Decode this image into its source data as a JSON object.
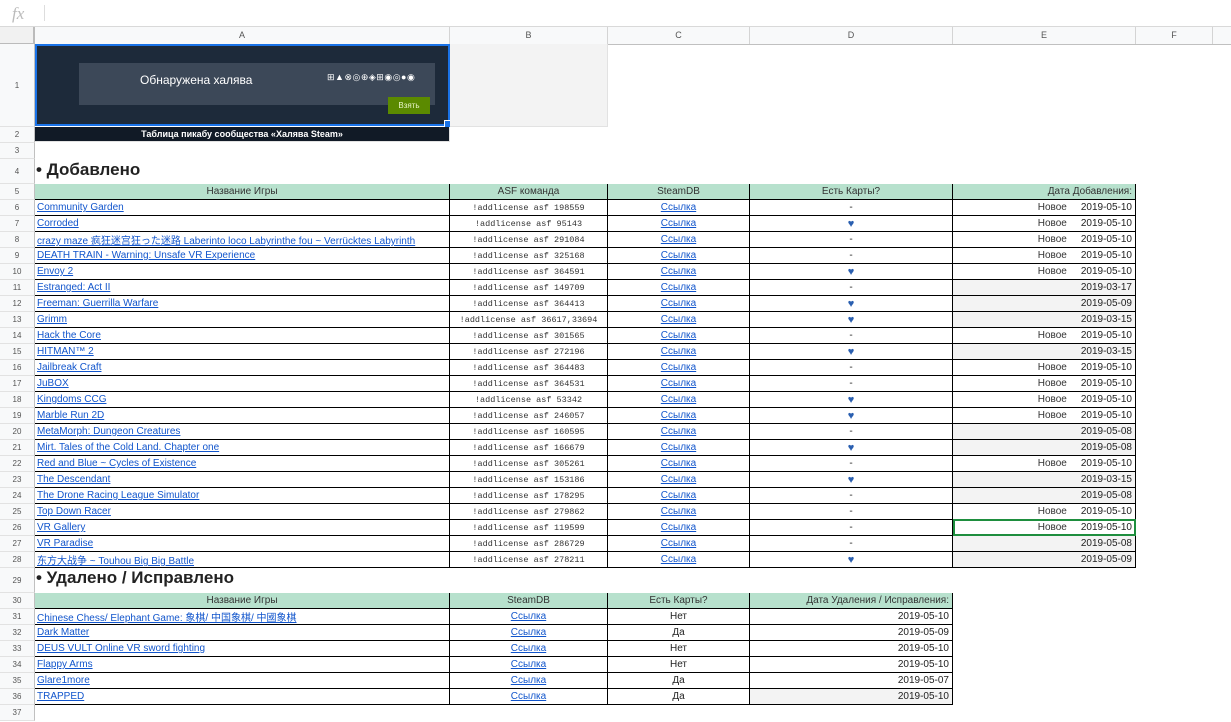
{
  "formula_bar": {
    "fx": "fx"
  },
  "columns": [
    "A",
    "B",
    "C",
    "D",
    "E",
    "F"
  ],
  "banner": {
    "title": "Обнаружена халява",
    "button": "Взять",
    "caption": "Таблица пикабу сообщества «Халява Steam»",
    "platform_icons": "⊞▲⊗◎⊕◈⊞◉◎●◉"
  },
  "added": {
    "title": "• Добавлено",
    "headers": [
      "Название Игры",
      "ASF команда",
      "SteamDB",
      "Есть Карты?",
      "Дата Добавления:"
    ],
    "rows": [
      {
        "name": "Community Garden",
        "asf": "!addlicense asf 198559",
        "db": "Ссылка",
        "cards": "-",
        "new": "Новое",
        "date": "2019-05-10"
      },
      {
        "name": "Corroded",
        "asf": "!addlicense asf 95143",
        "db": "Ссылка",
        "cards": "♥",
        "new": "Новое",
        "date": "2019-05-10"
      },
      {
        "name": "crazy maze 疯狂迷宫狂った迷路 Laberinto loco Labyrinthe fou ~ Verrücktes Labyrinth",
        "asf": "!addlicense asf 291084",
        "db": "Ссылка",
        "cards": "-",
        "new": "Новое",
        "date": "2019-05-10"
      },
      {
        "name": "DEATH TRAIN - Warning: Unsafe VR Experience",
        "asf": "!addlicense asf 325168",
        "db": "Ссылка",
        "cards": "-",
        "new": "Новое",
        "date": "2019-05-10"
      },
      {
        "name": "Envoy 2",
        "asf": "!addlicense asf 364591",
        "db": "Ссылка",
        "cards": "♥",
        "new": "Новое",
        "date": "2019-05-10"
      },
      {
        "name": "Estranged: Act II",
        "asf": "!addlicense asf 149709",
        "db": "Ссылка",
        "cards": "-",
        "new": "",
        "date": "2019-03-17"
      },
      {
        "name": "Freeman: Guerrilla Warfare",
        "asf": "!addlicense asf 364413",
        "db": "Ссылка",
        "cards": "♥",
        "new": "",
        "date": "2019-05-09"
      },
      {
        "name": "Grimm",
        "asf": "!addlicense asf 36617,33694",
        "db": "Ссылка",
        "cards": "♥",
        "new": "",
        "date": "2019-03-15"
      },
      {
        "name": "Hack the Core",
        "asf": "!addlicense asf 301565",
        "db": "Ссылка",
        "cards": "-",
        "new": "Новое",
        "date": "2019-05-10"
      },
      {
        "name": "HITMAN™ 2",
        "asf": "!addlicense asf 272196",
        "db": "Ссылка",
        "cards": "♥",
        "new": "",
        "date": "2019-03-15"
      },
      {
        "name": "Jailbreak Craft",
        "asf": "!addlicense asf 364483",
        "db": "Ссылка",
        "cards": "-",
        "new": "Новое",
        "date": "2019-05-10"
      },
      {
        "name": "JuBOX",
        "asf": "!addlicense asf 364531",
        "db": "Ссылка",
        "cards": "-",
        "new": "Новое",
        "date": "2019-05-10"
      },
      {
        "name": "Kingdoms CCG",
        "asf": "!addlicense asf 53342",
        "db": "Ссылка",
        "cards": "♥",
        "new": "Новое",
        "date": "2019-05-10"
      },
      {
        "name": "Marble Run 2D",
        "asf": "!addlicense asf 246057",
        "db": "Ссылка",
        "cards": "♥",
        "new": "Новое",
        "date": "2019-05-10"
      },
      {
        "name": "MetaMorph: Dungeon Creatures",
        "asf": "!addlicense asf 160595",
        "db": "Ссылка",
        "cards": "-",
        "new": "",
        "date": "2019-05-08"
      },
      {
        "name": "Mirt. Tales of the Cold Land. Chapter one",
        "asf": "!addlicense asf 166679",
        "db": "Ссылка",
        "cards": "♥",
        "new": "",
        "date": "2019-05-08"
      },
      {
        "name": "Red and Blue ~ Cycles of Existence",
        "asf": "!addlicense asf 305261",
        "db": "Ссылка",
        "cards": "-",
        "new": "Новое",
        "date": "2019-05-10"
      },
      {
        "name": "The Descendant",
        "asf": "!addlicense asf 153186",
        "db": "Ссылка",
        "cards": "♥",
        "new": "",
        "date": "2019-03-15"
      },
      {
        "name": "The Drone Racing League Simulator",
        "asf": "!addlicense asf 178295",
        "db": "Ссылка",
        "cards": "-",
        "new": "",
        "date": "2019-05-08"
      },
      {
        "name": "Top Down Racer",
        "asf": "!addlicense asf 279862",
        "db": "Ссылка",
        "cards": "-",
        "new": "Новое",
        "date": "2019-05-10"
      },
      {
        "name": "VR Gallery",
        "asf": "!addlicense asf 119599",
        "db": "Ссылка",
        "cards": "-",
        "new": "Новое",
        "date": "2019-05-10"
      },
      {
        "name": "VR Paradise",
        "asf": "!addlicense asf 286729",
        "db": "Ссылка",
        "cards": "-",
        "new": "",
        "date": "2019-05-08"
      },
      {
        "name": "东方大战争 ~ Touhou Big Big Battle",
        "asf": "!addlicense asf 278211",
        "db": "Ссылка",
        "cards": "♥",
        "new": "",
        "date": "2019-05-09"
      }
    ]
  },
  "removed": {
    "title": "• Удалено / Исправлено",
    "headers": [
      "Название Игры",
      "SteamDB",
      "Есть Карты?",
      "Дата Удаления / Исправления:"
    ],
    "rows": [
      {
        "name": "Chinese Chess/ Elephant Game: 象棋/ 中国象棋/ 中國象棋",
        "db": "Ссылка",
        "cards": "Нет",
        "date": "2019-05-10"
      },
      {
        "name": "Dark Matter",
        "db": "Ссылка",
        "cards": "Да",
        "date": "2019-05-09"
      },
      {
        "name": "DEUS VULT Online VR sword fighting",
        "db": "Ссылка",
        "cards": "Нет",
        "date": "2019-05-10"
      },
      {
        "name": "Flappy Arms",
        "db": "Ссылка",
        "cards": "Нет",
        "date": "2019-05-10"
      },
      {
        "name": "Glare1more",
        "db": "Ссылка",
        "cards": "Да",
        "date": "2019-05-07"
      },
      {
        "name": "TRAPPED",
        "db": "Ссылка",
        "cards": "Да",
        "date": "2019-05-10"
      }
    ]
  }
}
